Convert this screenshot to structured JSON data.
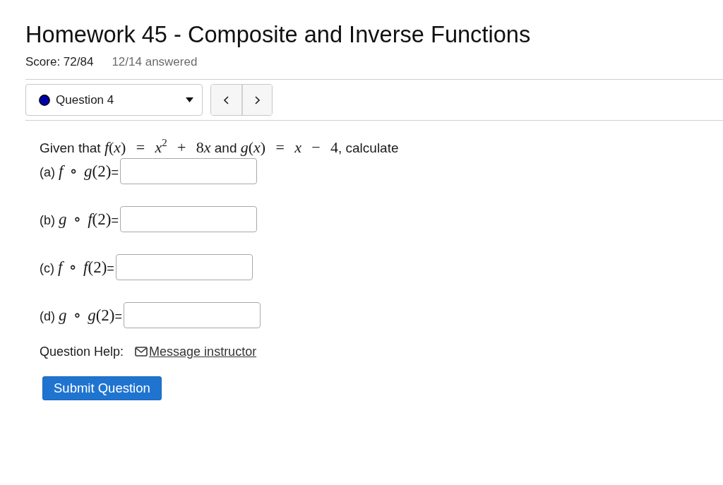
{
  "header": {
    "title": "Homework 45 - Composite and Inverse Functions",
    "score": "Score: 72/84",
    "answered": "12/14 answered"
  },
  "question_selector": {
    "label": "Question 4",
    "color": "#0000a8"
  },
  "question": {
    "prompt": [
      {
        "kind": "text",
        "text": "Given that "
      },
      {
        "kind": "math",
        "text": "*f*(*x*) = *x*$^{2}$ + 8"
      },
      {
        "kind": "math",
        "text": "*x*"
      },
      {
        "kind": "text",
        "text": " and "
      },
      {
        "kind": "math",
        "text": "*g*(*x*) = *x* − 4"
      },
      {
        "kind": "text",
        "text": ", calculate"
      }
    ],
    "parts": [
      {
        "label": "(a)",
        "expression": "*f* ∘ *g*(2)",
        "suffix": "="
      },
      {
        "label": "(b)",
        "expression": "*g* ∘ *f*(2)",
        "suffix": "="
      },
      {
        "label": "(c)",
        "expression": "*f* ∘ *f*(2)",
        "suffix": "="
      },
      {
        "label": "(d)",
        "expression": "*g* ∘ *g*(2)",
        "suffix": "="
      }
    ]
  },
  "help": {
    "label": "Question Help:",
    "link": "Message instructor"
  },
  "submit_button": "Submit Question"
}
